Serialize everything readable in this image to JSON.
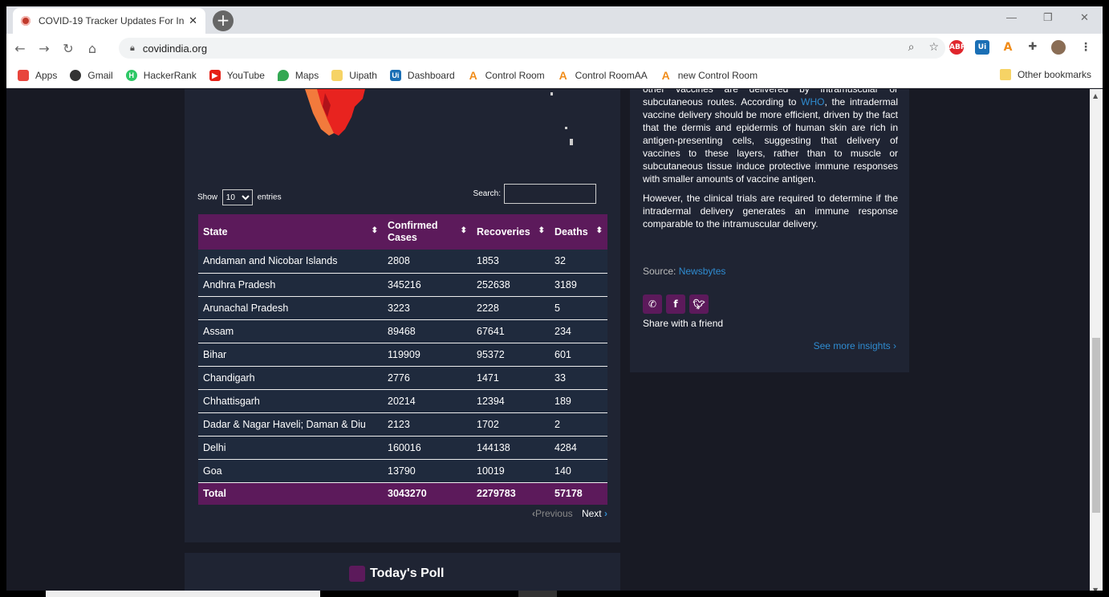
{
  "browser": {
    "tab_title": "COVID-19 Tracker Updates For In",
    "url": "covidindia.org",
    "bookmarks": [
      {
        "label": "Apps",
        "icon": "apps-grid-icon"
      },
      {
        "label": "Gmail",
        "icon": "github-icon"
      },
      {
        "label": "HackerRank",
        "icon": "hackerrank-icon"
      },
      {
        "label": "YouTube",
        "icon": "youtube-icon"
      },
      {
        "label": "Maps",
        "icon": "maps-pin-icon"
      },
      {
        "label": "Uipath",
        "icon": "folder-icon"
      },
      {
        "label": "Dashboard",
        "icon": "uipath-icon"
      },
      {
        "label": "Control Room",
        "icon": "automation-anywhere-icon"
      },
      {
        "label": "Control RoomAA",
        "icon": "automation-anywhere-icon"
      },
      {
        "label": "new Control Room",
        "icon": "automation-anywhere-icon"
      }
    ],
    "other_bookmarks": "Other bookmarks"
  },
  "table": {
    "show_label": "Show",
    "entries_value": "10",
    "entries_label": "entries",
    "search_label": "Search:",
    "headers": [
      "State",
      "Confirmed Cases",
      "Recoveries",
      "Deaths"
    ],
    "rows": [
      [
        "Andaman and Nicobar Islands",
        "2808",
        "1853",
        "32"
      ],
      [
        "Andhra Pradesh",
        "345216",
        "252638",
        "3189"
      ],
      [
        "Arunachal Pradesh",
        "3223",
        "2228",
        "5"
      ],
      [
        "Assam",
        "89468",
        "67641",
        "234"
      ],
      [
        "Bihar",
        "119909",
        "95372",
        "601"
      ],
      [
        "Chandigarh",
        "2776",
        "1471",
        "33"
      ],
      [
        "Chhattisgarh",
        "20214",
        "12394",
        "189"
      ],
      [
        "Dadar & Nagar Haveli; Daman & Diu",
        "2123",
        "1702",
        "2"
      ],
      [
        "Delhi",
        "160016",
        "144138",
        "4284"
      ],
      [
        "Goa",
        "13790",
        "10019",
        "140"
      ]
    ],
    "total": [
      "Total",
      "3043270",
      "2279783",
      "57178"
    ],
    "prev_label": "Previous",
    "next_label": "Next"
  },
  "poll": {
    "title": "Today's Poll"
  },
  "article": {
    "p1_lead": "other vaccines are delivered by intramuscular or subcutaneous routes. According to ",
    "p1_link": "WHO",
    "p1_rest": ", the intradermal vaccine delivery should be more efficient, driven by the fact that the dermis and epidermis of human skin are rich in antigen-presenting cells, suggesting that delivery of vaccines to these layers, rather than to muscle or subcutaneous tissue induce protective immune responses with smaller amounts of vaccine antigen.",
    "p2": "However, the clinical trials are required to determine if the intradermal delivery generates an immune response comparable to the intramuscular delivery.",
    "source_label": "Source: ",
    "source_link": "Newsbytes",
    "share_text": "Share with a friend",
    "see_more": "See more insights ›"
  },
  "colors": {
    "accent": "#5c1a5b",
    "link": "#2f8cd1",
    "card": "#1f2433",
    "page": "#181a24"
  }
}
